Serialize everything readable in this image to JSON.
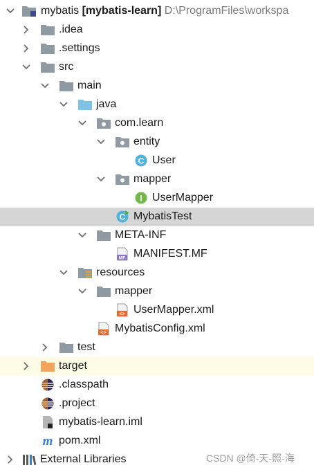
{
  "tree": {
    "root": {
      "name": "mybatis",
      "module": "[mybatis-learn]",
      "path": "D:\\ProgramFiles\\workspa"
    },
    "idea": ".idea",
    "settings": ".settings",
    "src": "src",
    "main": "main",
    "java": "java",
    "package": "com.learn",
    "entity": "entity",
    "user": "User",
    "mapper_pkg": "mapper",
    "user_mapper": "UserMapper",
    "mybatis_test": "MybatisTest",
    "meta_inf": "META-INF",
    "manifest": "MANIFEST.MF",
    "resources": "resources",
    "res_mapper": "mapper",
    "user_mapper_xml": "UserMapper.xml",
    "mybatis_config": "MybatisConfig.xml",
    "test": "test",
    "target": "target",
    "classpath": ".classpath",
    "project": ".project",
    "iml": "mybatis-learn.iml",
    "pom": "pom.xml",
    "external": "External Libraries"
  },
  "icon_text": {
    "class": "C",
    "interface": "I",
    "maven": "m",
    "xml": "<>",
    "manifest": "MF"
  },
  "watermark": "CSDN @倚-天-照-海",
  "colors": {
    "folder": "#8f9aa3",
    "source_folder": "#7ec3e6",
    "target_folder": "#f2a35e",
    "class": "#4fb3d9",
    "interface": "#73b84a",
    "xml": "#e86a2f",
    "maven": "#3b7fd4",
    "selection": "#d6d6d6"
  }
}
